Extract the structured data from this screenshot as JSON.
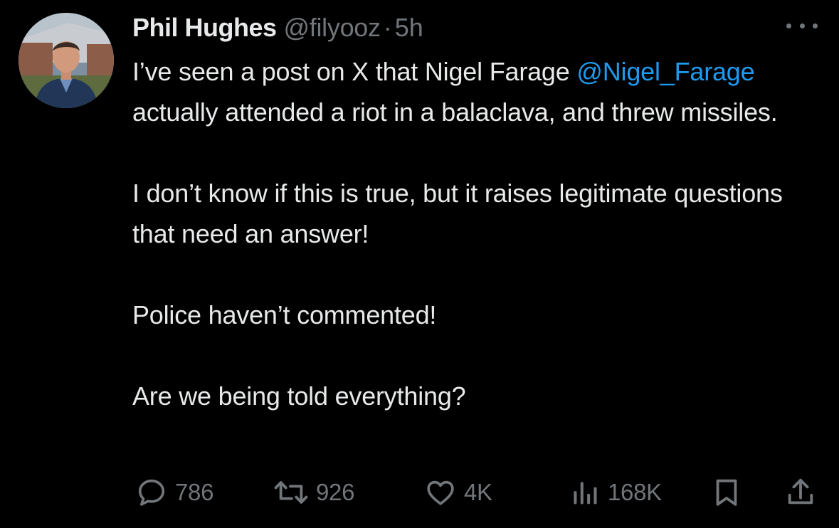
{
  "author": {
    "display_name": "Phil Hughes",
    "handle": "@filyooz",
    "separator": "·",
    "time": "5h",
    "avatar_icon": "profile-photo"
  },
  "more_icon": "more-horizontal-icon",
  "post": {
    "p1_before": "I’ve seen a post on X that Nigel Farage ",
    "p1_mention": "@Nigel_Farage",
    "p1_after": " actually attended a riot in a balaclava, and threw missiles.",
    "p2": "I don’t know if this is true, but it raises legitimate questions that need an answer!",
    "p3": "Police haven’t commented!",
    "p4": "Are we being told everything?"
  },
  "actions": {
    "replies": "786",
    "reposts": "926",
    "likes": "4K",
    "views": "168K"
  },
  "colors": {
    "background": "#000000",
    "text": "#e7e9ea",
    "muted": "#71767b",
    "link": "#1d9bf0"
  }
}
